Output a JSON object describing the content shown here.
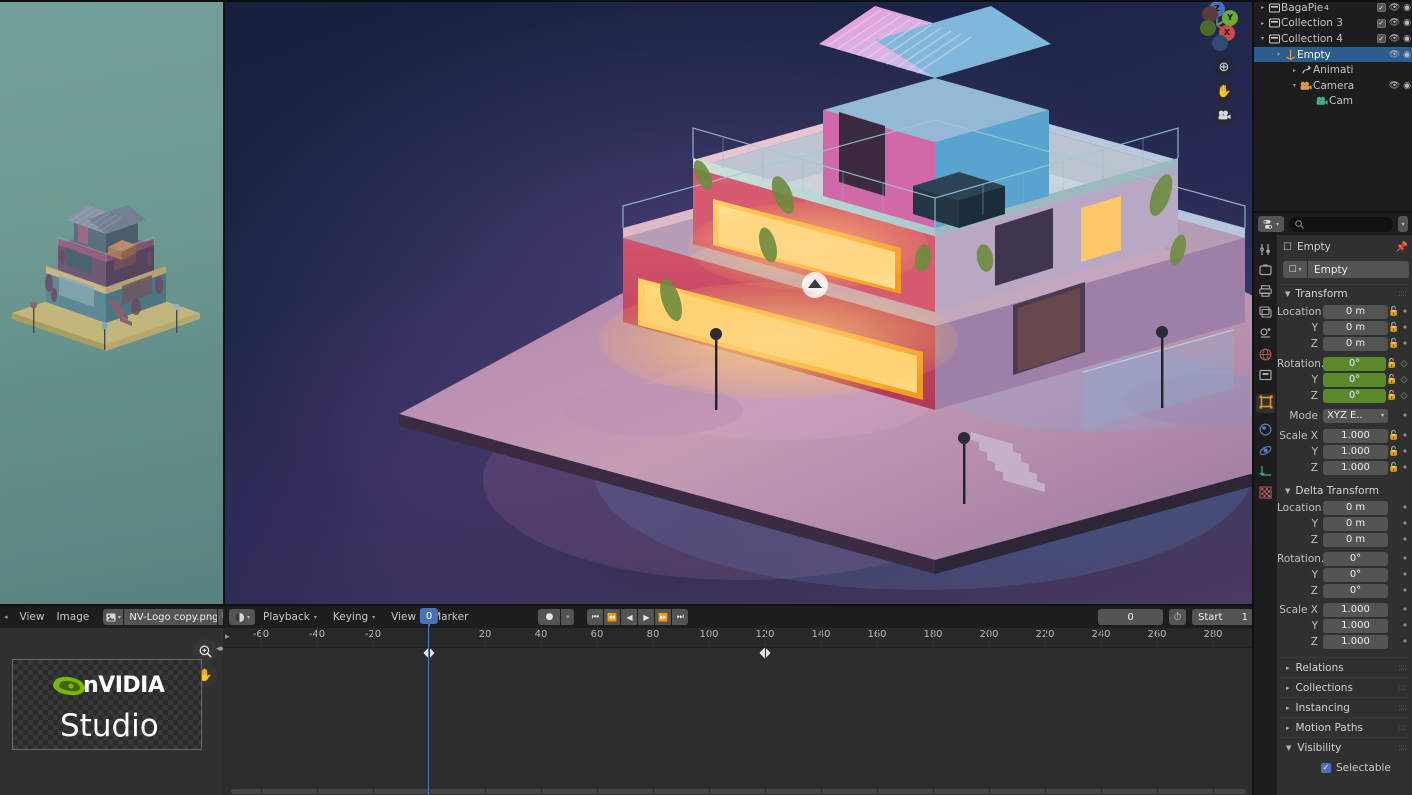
{
  "app": {
    "name": "Blender",
    "theme_accent": "#4772b3"
  },
  "image_editor": {
    "menus": [
      "View",
      "Image"
    ],
    "datablock_name": "NV-Logo copy.png",
    "logo": {
      "brand": "nVIDIA",
      "product": "Studio",
      "brand_color": "#76b900"
    },
    "tools": [
      {
        "name": "zoom-icon",
        "glyph": "⊕"
      },
      {
        "name": "pan-hand-icon",
        "glyph": "✋"
      }
    ]
  },
  "outliner": {
    "rows": [
      {
        "name": "BagaPie",
        "icon": "modifier",
        "indent": 0,
        "expand": "▸",
        "selected": false,
        "badge": "4",
        "checkbox": true,
        "eye": true,
        "camera": true
      },
      {
        "name": "Collection 3",
        "icon": "collection",
        "indent": 0,
        "expand": "▸",
        "selected": false,
        "checkbox": true,
        "eye": true,
        "camera": true
      },
      {
        "name": "Collection 4",
        "icon": "collection",
        "indent": 0,
        "expand": "▾",
        "selected": false,
        "checkbox": true,
        "eye": true,
        "camera": true
      },
      {
        "name": "Empty",
        "icon": "empty-axis",
        "indent": 1,
        "expand": "▾",
        "selected": true,
        "checkbox": false,
        "eye": true,
        "camera": true
      },
      {
        "name": "Animati",
        "icon": "animation-data",
        "indent": 2,
        "expand": "▸",
        "selected": false,
        "checkbox": false,
        "eye": false,
        "camera": false
      },
      {
        "name": "Camera",
        "icon": "camera-object",
        "indent": 2,
        "expand": "▾",
        "selected": false,
        "checkbox": false,
        "eye": true,
        "camera": true
      },
      {
        "name": "Cam",
        "icon": "camera-data",
        "indent": 3,
        "expand": "",
        "selected": false,
        "checkbox": false,
        "eye": false,
        "camera": false
      }
    ]
  },
  "properties": {
    "search_placeholder": "",
    "breadcrumb": "Empty",
    "object_name": "Empty",
    "tabs": [
      {
        "name": "tool",
        "glyph": "⚒",
        "active": false
      },
      {
        "name": "render",
        "glyph": "▣",
        "active": false
      },
      {
        "name": "output",
        "glyph": "⎙",
        "active": false
      },
      {
        "name": "view-layer",
        "glyph": "❑",
        "active": false
      },
      {
        "name": "scene",
        "glyph": "◔",
        "active": false
      },
      {
        "name": "world",
        "glyph": "❂",
        "active": false
      },
      {
        "name": "collection",
        "glyph": "❐",
        "active": false
      },
      {
        "name": "object",
        "glyph": "▣",
        "active": true
      },
      {
        "name": "modifiers",
        "glyph": "◉",
        "active": false
      },
      {
        "name": "physics",
        "glyph": "◌",
        "active": false
      },
      {
        "name": "object-constraints",
        "glyph": "┳",
        "active": false
      },
      {
        "name": "object-data",
        "glyph": "░",
        "active": false
      }
    ],
    "transform": {
      "title": "Transform",
      "location": {
        "label": "Location",
        "x": "0 m",
        "y": "0 m",
        "z": "0 m"
      },
      "rotation": {
        "label": "Rotation..",
        "x": "0°",
        "y": "0°",
        "z": "0°"
      },
      "mode": {
        "label": "Mode",
        "value": "XYZ E.."
      },
      "scale": {
        "label": "Scale X",
        "x": "1.000",
        "y": "1.000",
        "z": "1.000"
      },
      "axis_y": "Y",
      "axis_z": "Z"
    },
    "delta_transform": {
      "title": "Delta Transform",
      "location": {
        "label": "Location",
        "x": "0 m",
        "y": "0 m",
        "z": "0 m"
      },
      "rotation": {
        "label": "Rotation..",
        "x": "0°",
        "y": "0°",
        "z": "0°"
      },
      "scale": {
        "label": "Scale X",
        "x": "1.000",
        "y": "1.000",
        "z": "1.000"
      }
    },
    "collapsed_panels": [
      "Relations",
      "Collections",
      "Instancing",
      "Motion Paths"
    ],
    "visibility": {
      "title": "Visibility",
      "selectable_label": "Selectable",
      "selectable_checked": true
    }
  },
  "timeline": {
    "menus": [
      "Playback",
      "Keying",
      "View",
      "Marker"
    ],
    "playback_controls": [
      "jump-start",
      "prev-keyframe",
      "play-reverse",
      "play",
      "next-keyframe",
      "jump-end"
    ],
    "current_frame": "0",
    "start_label": "Start",
    "start_value": "1",
    "ruler_ticks": [
      -60,
      -40,
      -20,
      0,
      20,
      40,
      60,
      80,
      100,
      120,
      140,
      160,
      180,
      200,
      220,
      240,
      260,
      280
    ],
    "playhead_frame": 0,
    "keyframes": [
      0,
      120
    ]
  },
  "viewport": {
    "gizmo_axes": [
      {
        "label": "Z",
        "color": "#4772b3"
      },
      {
        "label": "Y",
        "color": "#6eab2f"
      },
      {
        "label": "X",
        "color": "#cd4a4a"
      }
    ],
    "tools": [
      {
        "name": "zoom-view-icon",
        "glyph": "⊕"
      },
      {
        "name": "pan-view-icon",
        "glyph": "✋"
      },
      {
        "name": "camera-view-icon",
        "glyph": "🎥"
      }
    ]
  }
}
